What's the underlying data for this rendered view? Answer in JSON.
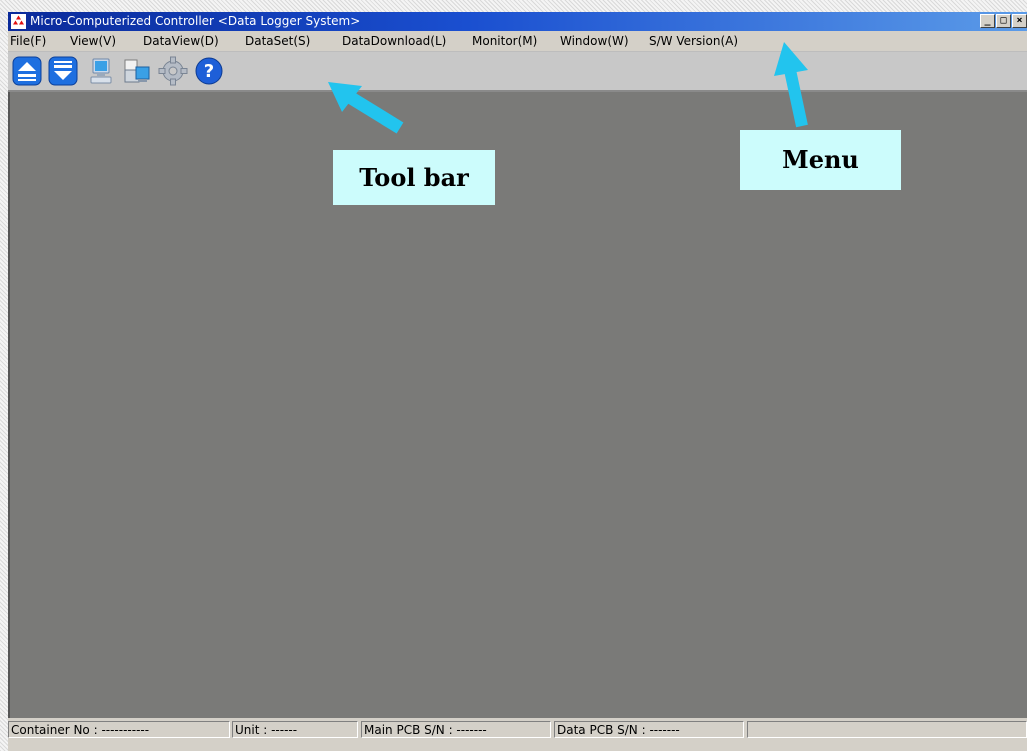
{
  "window": {
    "title": "Micro-Computerized Controller <Data Logger System>",
    "controls": {
      "minimize": "_",
      "maximize": "□",
      "close": "×"
    }
  },
  "menu": {
    "items": [
      {
        "label": "File(F)"
      },
      {
        "label": "View(V)"
      },
      {
        "label": "DataView(D)"
      },
      {
        "label": "DataSet(S)"
      },
      {
        "label": "DataDownload(L)"
      },
      {
        "label": "Monitor(M)"
      },
      {
        "label": "Window(W)"
      },
      {
        "label": "S/W Version(A)"
      }
    ]
  },
  "toolbar": {
    "buttons": [
      {
        "icon": "eject-up-icon"
      },
      {
        "icon": "download-down-icon"
      },
      {
        "icon": "computer-icon"
      },
      {
        "icon": "printer-computer-icon"
      },
      {
        "icon": "gear-icon"
      },
      {
        "icon": "help-icon"
      }
    ]
  },
  "statusbar": {
    "container": "Container No : -----------",
    "unit": "Unit : ------",
    "main_pcb": "Main PCB S/N : -------",
    "data_pcb": "Data PCB S/N : -------"
  },
  "annotations": {
    "toolbar_label": "Tool bar",
    "menu_label": "Menu"
  },
  "colors": {
    "callout_bg": "#ccfcfc",
    "arrow": "#22c4ee",
    "workspace": "#7a7a78"
  }
}
